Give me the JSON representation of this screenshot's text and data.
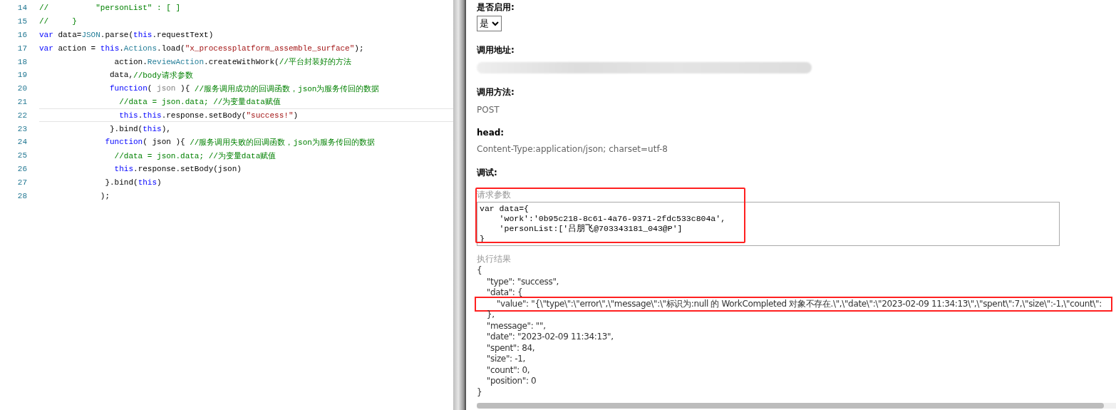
{
  "code_editor": {
    "lines": [
      {
        "number": "14",
        "current": false,
        "tokens": [
          {
            "kind": "comment",
            "text": "//          \"personList\" : [ ]"
          }
        ]
      },
      {
        "number": "15",
        "current": false,
        "tokens": [
          {
            "kind": "comment",
            "text": "//     }"
          }
        ]
      },
      {
        "number": "16",
        "current": false,
        "tokens": [
          {
            "kind": "keyword",
            "text": "var"
          },
          {
            "kind": "plain",
            "text": " data="
          },
          {
            "kind": "type",
            "text": "JSON"
          },
          {
            "kind": "plain",
            "text": ".parse("
          },
          {
            "kind": "keyword",
            "text": "this"
          },
          {
            "kind": "plain",
            "text": ".requestText)"
          }
        ]
      },
      {
        "number": "17",
        "current": false,
        "tokens": [
          {
            "kind": "keyword",
            "text": "var"
          },
          {
            "kind": "plain",
            "text": " action = "
          },
          {
            "kind": "keyword",
            "text": "this"
          },
          {
            "kind": "plain",
            "text": "."
          },
          {
            "kind": "type",
            "text": "Actions"
          },
          {
            "kind": "plain",
            "text": ".load("
          },
          {
            "kind": "string",
            "text": "\"x_processplatform_assemble_surface\""
          },
          {
            "kind": "plain",
            "text": ");"
          }
        ]
      },
      {
        "number": "18",
        "current": false,
        "tokens": [
          {
            "kind": "plain",
            "text": "                action."
          },
          {
            "kind": "type",
            "text": "ReviewAction"
          },
          {
            "kind": "plain",
            "text": ".createWithWork("
          },
          {
            "kind": "comment",
            "text": "//平台封装好的方法"
          }
        ]
      },
      {
        "number": "19",
        "current": false,
        "tokens": [
          {
            "kind": "plain",
            "text": "               data,"
          },
          {
            "kind": "comment",
            "text": "//body请求参数"
          }
        ]
      },
      {
        "number": "20",
        "current": false,
        "tokens": [
          {
            "kind": "keyword",
            "text": "               function"
          },
          {
            "kind": "plain",
            "text": "( "
          },
          {
            "kind": "param",
            "text": "json"
          },
          {
            "kind": "plain",
            "text": " ){ "
          },
          {
            "kind": "comment",
            "text": "//服务调用成功的回调函数，json为服务传回的数据"
          }
        ]
      },
      {
        "number": "21",
        "current": false,
        "tokens": [
          {
            "kind": "comment",
            "text": "                 //data = json.data; //为变量data赋值"
          }
        ]
      },
      {
        "number": "22",
        "current": true,
        "tokens": [
          {
            "kind": "keyword",
            "text": "                 this"
          },
          {
            "kind": "plain",
            "text": "."
          },
          {
            "kind": "keyword",
            "text": "this"
          },
          {
            "kind": "plain",
            "text": ".response.setBody("
          },
          {
            "kind": "string",
            "text": "\"success!\""
          },
          {
            "kind": "plain",
            "text": ")"
          }
        ]
      },
      {
        "number": "23",
        "current": false,
        "tokens": [
          {
            "kind": "plain",
            "text": "               }.bind("
          },
          {
            "kind": "keyword",
            "text": "this"
          },
          {
            "kind": "plain",
            "text": "),"
          }
        ]
      },
      {
        "number": "24",
        "current": false,
        "tokens": [
          {
            "kind": "keyword",
            "text": "              function"
          },
          {
            "kind": "plain",
            "text": "( json ){ "
          },
          {
            "kind": "comment",
            "text": "//服务调用失败的回调函数，json为服务传回的数据"
          }
        ]
      },
      {
        "number": "25",
        "current": false,
        "tokens": [
          {
            "kind": "comment",
            "text": "                //data = json.data; //为变量data赋值"
          }
        ]
      },
      {
        "number": "26",
        "current": false,
        "tokens": [
          {
            "kind": "keyword",
            "text": "                this"
          },
          {
            "kind": "plain",
            "text": ".response.setBody(json)"
          }
        ]
      },
      {
        "number": "27",
        "current": false,
        "tokens": [
          {
            "kind": "plain",
            "text": "              }.bind("
          },
          {
            "kind": "keyword",
            "text": "this"
          },
          {
            "kind": "plain",
            "text": ")"
          }
        ]
      },
      {
        "number": "28",
        "current": false,
        "tokens": [
          {
            "kind": "plain",
            "text": "             );"
          }
        ]
      }
    ]
  },
  "service_form": {
    "enabled": {
      "label": "是否启用:",
      "value": "是"
    },
    "address": {
      "label": "调用地址:"
    },
    "method": {
      "label": "调用方法:",
      "value": "POST"
    },
    "head": {
      "label": "head:",
      "value": "Content-Type:application/json; charset=utf-8"
    },
    "debug": {
      "label": "调试:"
    },
    "request": {
      "label": "请求参数",
      "highlighted": true,
      "value": "var data={\n    'work':'0b95c218-8c61-4a76-9371-2fdc533c804a',\n    'personList:['吕朋飞@703343181_043@P']\n}"
    },
    "result": {
      "label": "执行结果",
      "lines": [
        {
          "text": "{",
          "highlighted": false
        },
        {
          "text": "    \"type\": \"success\",",
          "highlighted": false
        },
        {
          "text": "    \"data\": {",
          "highlighted": false
        },
        {
          "text": "        \"value\": \"{\\\"type\\\":\\\"error\\\",\\\"message\\\":\\\"标识为:null 的 WorkCompleted 对象不存在.\\\",\\\"date\\\":\\\"2023-02-09 11:34:13\\\",\\\"spent\\\":7,\\\"size\\\":-1,\\\"count\\\":",
          "highlighted": true
        },
        {
          "text": "    },",
          "highlighted": false
        },
        {
          "text": "    \"message\": \"\",",
          "highlighted": false
        },
        {
          "text": "    \"date\": \"2023-02-09 11:34:13\",",
          "highlighted": false
        },
        {
          "text": "    \"spent\": 84,",
          "highlighted": false
        },
        {
          "text": "    \"size\": -1,",
          "highlighted": false
        },
        {
          "text": "    \"count\": 0,",
          "highlighted": false
        },
        {
          "text": "    \"position\": 0",
          "highlighted": false
        },
        {
          "text": "}",
          "highlighted": false
        }
      ]
    }
  }
}
